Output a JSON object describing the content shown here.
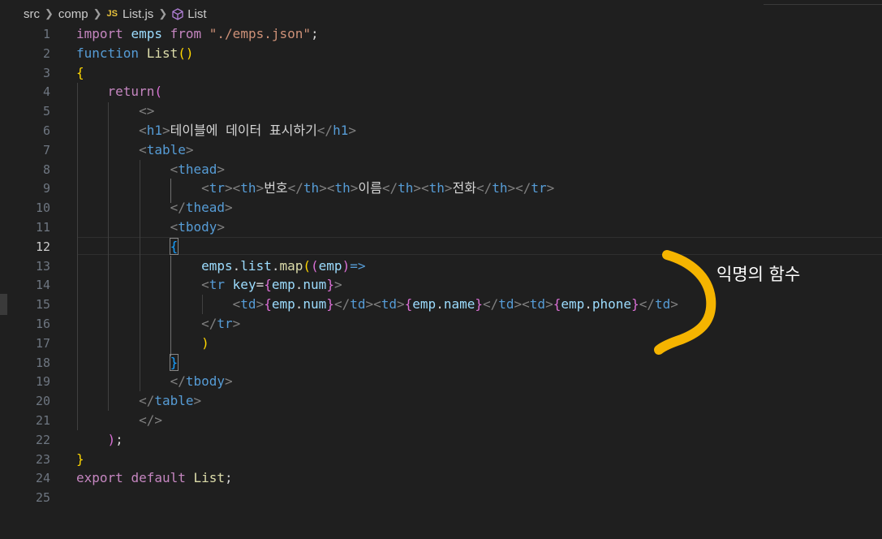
{
  "breadcrumb": {
    "items": [
      "src",
      "comp",
      "List.js",
      "List"
    ],
    "js_badge": "JS"
  },
  "annotation": {
    "text": "익명의 함수",
    "mark_color": "#f5b400"
  },
  "editor": {
    "current_line": 12,
    "lines": [
      {
        "n": "1",
        "tokens": [
          {
            "c": "kw",
            "t": "import"
          },
          {
            "c": "txt",
            "t": " "
          },
          {
            "c": "va",
            "t": "emps"
          },
          {
            "c": "txt",
            "t": " "
          },
          {
            "c": "kw",
            "t": "from"
          },
          {
            "c": "txt",
            "t": " "
          },
          {
            "c": "str",
            "t": "\"./emps.json\""
          },
          {
            "c": "txt",
            "t": ";"
          }
        ]
      },
      {
        "n": "2",
        "tokens": [
          {
            "c": "st",
            "t": "function"
          },
          {
            "c": "txt",
            "t": " "
          },
          {
            "c": "fn",
            "t": "List"
          },
          {
            "c": "b1",
            "t": "()"
          }
        ]
      },
      {
        "n": "3",
        "tokens": [
          {
            "c": "b1",
            "t": "{"
          }
        ]
      },
      {
        "n": "4",
        "tokens": [
          {
            "c": "txt",
            "t": "    "
          },
          {
            "c": "kw",
            "t": "return"
          },
          {
            "c": "b2",
            "t": "("
          }
        ]
      },
      {
        "n": "5",
        "tokens": [
          {
            "c": "txt",
            "t": "        "
          },
          {
            "c": "pun",
            "t": "<>"
          }
        ]
      },
      {
        "n": "6",
        "tokens": [
          {
            "c": "txt",
            "t": "        "
          },
          {
            "c": "pun",
            "t": "<"
          },
          {
            "c": "tag",
            "t": "h1"
          },
          {
            "c": "pun",
            "t": ">"
          },
          {
            "c": "txt",
            "t": "테이블에 데이터 표시하기"
          },
          {
            "c": "pun",
            "t": "</"
          },
          {
            "c": "tag",
            "t": "h1"
          },
          {
            "c": "pun",
            "t": ">"
          }
        ]
      },
      {
        "n": "7",
        "tokens": [
          {
            "c": "txt",
            "t": "        "
          },
          {
            "c": "pun",
            "t": "<"
          },
          {
            "c": "tag",
            "t": "table"
          },
          {
            "c": "pun",
            "t": ">"
          }
        ]
      },
      {
        "n": "8",
        "tokens": [
          {
            "c": "txt",
            "t": "            "
          },
          {
            "c": "pun",
            "t": "<"
          },
          {
            "c": "tag",
            "t": "thead"
          },
          {
            "c": "pun",
            "t": ">"
          }
        ]
      },
      {
        "n": "9",
        "tokens": [
          {
            "c": "txt",
            "t": "                "
          },
          {
            "c": "pun",
            "t": "<"
          },
          {
            "c": "tag",
            "t": "tr"
          },
          {
            "c": "pun",
            "t": "><"
          },
          {
            "c": "tag",
            "t": "th"
          },
          {
            "c": "pun",
            "t": ">"
          },
          {
            "c": "txt",
            "t": "번호"
          },
          {
            "c": "pun",
            "t": "</"
          },
          {
            "c": "tag",
            "t": "th"
          },
          {
            "c": "pun",
            "t": "><"
          },
          {
            "c": "tag",
            "t": "th"
          },
          {
            "c": "pun",
            "t": ">"
          },
          {
            "c": "txt",
            "t": "이름"
          },
          {
            "c": "pun",
            "t": "</"
          },
          {
            "c": "tag",
            "t": "th"
          },
          {
            "c": "pun",
            "t": "><"
          },
          {
            "c": "tag",
            "t": "th"
          },
          {
            "c": "pun",
            "t": ">"
          },
          {
            "c": "txt",
            "t": "전화"
          },
          {
            "c": "pun",
            "t": "</"
          },
          {
            "c": "tag",
            "t": "th"
          },
          {
            "c": "pun",
            "t": "></"
          },
          {
            "c": "tag",
            "t": "tr"
          },
          {
            "c": "pun",
            "t": ">"
          }
        ]
      },
      {
        "n": "10",
        "tokens": [
          {
            "c": "txt",
            "t": "            "
          },
          {
            "c": "pun",
            "t": "</"
          },
          {
            "c": "tag",
            "t": "thead"
          },
          {
            "c": "pun",
            "t": ">"
          }
        ]
      },
      {
        "n": "11",
        "tokens": [
          {
            "c": "txt",
            "t": "            "
          },
          {
            "c": "pun",
            "t": "<"
          },
          {
            "c": "tag",
            "t": "tbody"
          },
          {
            "c": "pun",
            "t": ">"
          }
        ]
      },
      {
        "n": "12",
        "tokens": [
          {
            "c": "txt",
            "t": "            "
          },
          {
            "c": "b3 sel",
            "t": "{"
          }
        ]
      },
      {
        "n": "13",
        "tokens": [
          {
            "c": "txt",
            "t": "                "
          },
          {
            "c": "va",
            "t": "emps"
          },
          {
            "c": "txt",
            "t": "."
          },
          {
            "c": "va",
            "t": "list"
          },
          {
            "c": "txt",
            "t": "."
          },
          {
            "c": "fn",
            "t": "map"
          },
          {
            "c": "b1",
            "t": "("
          },
          {
            "c": "b2",
            "t": "("
          },
          {
            "c": "va",
            "t": "emp"
          },
          {
            "c": "b2",
            "t": ")"
          },
          {
            "c": "st",
            "t": "=>"
          }
        ]
      },
      {
        "n": "14",
        "tokens": [
          {
            "c": "txt",
            "t": "                "
          },
          {
            "c": "pun",
            "t": "<"
          },
          {
            "c": "tag",
            "t": "tr"
          },
          {
            "c": "txt",
            "t": " "
          },
          {
            "c": "va",
            "t": "key"
          },
          {
            "c": "txt",
            "t": "="
          },
          {
            "c": "b2",
            "t": "{"
          },
          {
            "c": "va",
            "t": "emp"
          },
          {
            "c": "txt",
            "t": "."
          },
          {
            "c": "va",
            "t": "num"
          },
          {
            "c": "b2",
            "t": "}"
          },
          {
            "c": "pun",
            "t": ">"
          }
        ]
      },
      {
        "n": "15",
        "tokens": [
          {
            "c": "txt",
            "t": "                    "
          },
          {
            "c": "pun",
            "t": "<"
          },
          {
            "c": "tag",
            "t": "td"
          },
          {
            "c": "pun",
            "t": ">"
          },
          {
            "c": "b2",
            "t": "{"
          },
          {
            "c": "va",
            "t": "emp"
          },
          {
            "c": "txt",
            "t": "."
          },
          {
            "c": "va",
            "t": "num"
          },
          {
            "c": "b2",
            "t": "}"
          },
          {
            "c": "pun",
            "t": "</"
          },
          {
            "c": "tag",
            "t": "td"
          },
          {
            "c": "pun",
            "t": "><"
          },
          {
            "c": "tag",
            "t": "td"
          },
          {
            "c": "pun",
            "t": ">"
          },
          {
            "c": "b2",
            "t": "{"
          },
          {
            "c": "va",
            "t": "emp"
          },
          {
            "c": "txt",
            "t": "."
          },
          {
            "c": "va",
            "t": "name"
          },
          {
            "c": "b2",
            "t": "}"
          },
          {
            "c": "pun",
            "t": "</"
          },
          {
            "c": "tag",
            "t": "td"
          },
          {
            "c": "pun",
            "t": "><"
          },
          {
            "c": "tag",
            "t": "td"
          },
          {
            "c": "pun",
            "t": ">"
          },
          {
            "c": "b2",
            "t": "{"
          },
          {
            "c": "va",
            "t": "emp"
          },
          {
            "c": "txt",
            "t": "."
          },
          {
            "c": "va",
            "t": "phone"
          },
          {
            "c": "b2",
            "t": "}"
          },
          {
            "c": "pun",
            "t": "</"
          },
          {
            "c": "tag",
            "t": "td"
          },
          {
            "c": "pun",
            "t": ">"
          }
        ]
      },
      {
        "n": "16",
        "tokens": [
          {
            "c": "txt",
            "t": "                "
          },
          {
            "c": "pun",
            "t": "</"
          },
          {
            "c": "tag",
            "t": "tr"
          },
          {
            "c": "pun",
            "t": ">"
          }
        ]
      },
      {
        "n": "17",
        "tokens": [
          {
            "c": "txt",
            "t": "                "
          },
          {
            "c": "b1",
            "t": ")"
          }
        ]
      },
      {
        "n": "18",
        "tokens": [
          {
            "c": "txt",
            "t": "            "
          },
          {
            "c": "b3 sel",
            "t": "}"
          }
        ]
      },
      {
        "n": "19",
        "tokens": [
          {
            "c": "txt",
            "t": "            "
          },
          {
            "c": "pun",
            "t": "</"
          },
          {
            "c": "tag",
            "t": "tbody"
          },
          {
            "c": "pun",
            "t": ">"
          }
        ]
      },
      {
        "n": "20",
        "tokens": [
          {
            "c": "txt",
            "t": "        "
          },
          {
            "c": "pun",
            "t": "</"
          },
          {
            "c": "tag",
            "t": "table"
          },
          {
            "c": "pun",
            "t": ">"
          }
        ]
      },
      {
        "n": "21",
        "tokens": [
          {
            "c": "txt",
            "t": "        "
          },
          {
            "c": "pun",
            "t": "</>"
          }
        ]
      },
      {
        "n": "22",
        "tokens": [
          {
            "c": "txt",
            "t": "    "
          },
          {
            "c": "b2",
            "t": ")"
          },
          {
            "c": "txt",
            "t": ";"
          }
        ]
      },
      {
        "n": "23",
        "tokens": [
          {
            "c": "b1",
            "t": "}"
          }
        ]
      },
      {
        "n": "24",
        "tokens": [
          {
            "c": "kw",
            "t": "export"
          },
          {
            "c": "txt",
            "t": " "
          },
          {
            "c": "kw",
            "t": "default"
          },
          {
            "c": "txt",
            "t": " "
          },
          {
            "c": "fn",
            "t": "List"
          },
          {
            "c": "txt",
            "t": ";"
          }
        ]
      },
      {
        "n": "25",
        "tokens": []
      }
    ]
  }
}
